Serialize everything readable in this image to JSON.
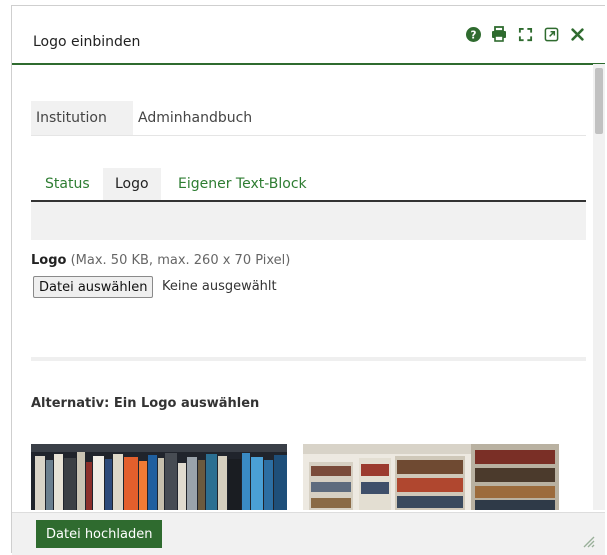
{
  "dialog": {
    "title": "Logo einbinden"
  },
  "toolbar": {
    "icons": [
      "help-icon",
      "print-icon",
      "fullscreen-icon",
      "external-window-icon",
      "close-icon"
    ]
  },
  "institution": {
    "label": "Institution",
    "value": "Adminhandbuch"
  },
  "tabs": [
    {
      "label": "Status",
      "active": false
    },
    {
      "label": "Logo",
      "active": true
    },
    {
      "label": "Eigener Text-Block",
      "active": false
    }
  ],
  "logo": {
    "label": "Logo",
    "hint": "(Max. 50 KB, max. 260 x 70 Pixel)",
    "file_button": "Datei auswählen",
    "file_status": "Keine ausgewählt"
  },
  "alternative": {
    "heading": "Alternativ: Ein Logo auswählen"
  },
  "footer": {
    "upload_button": "Datei hochladen"
  },
  "colors": {
    "accent": "#2f6b2f",
    "link": "#2e7d32",
    "band": "#f1f1f1"
  }
}
